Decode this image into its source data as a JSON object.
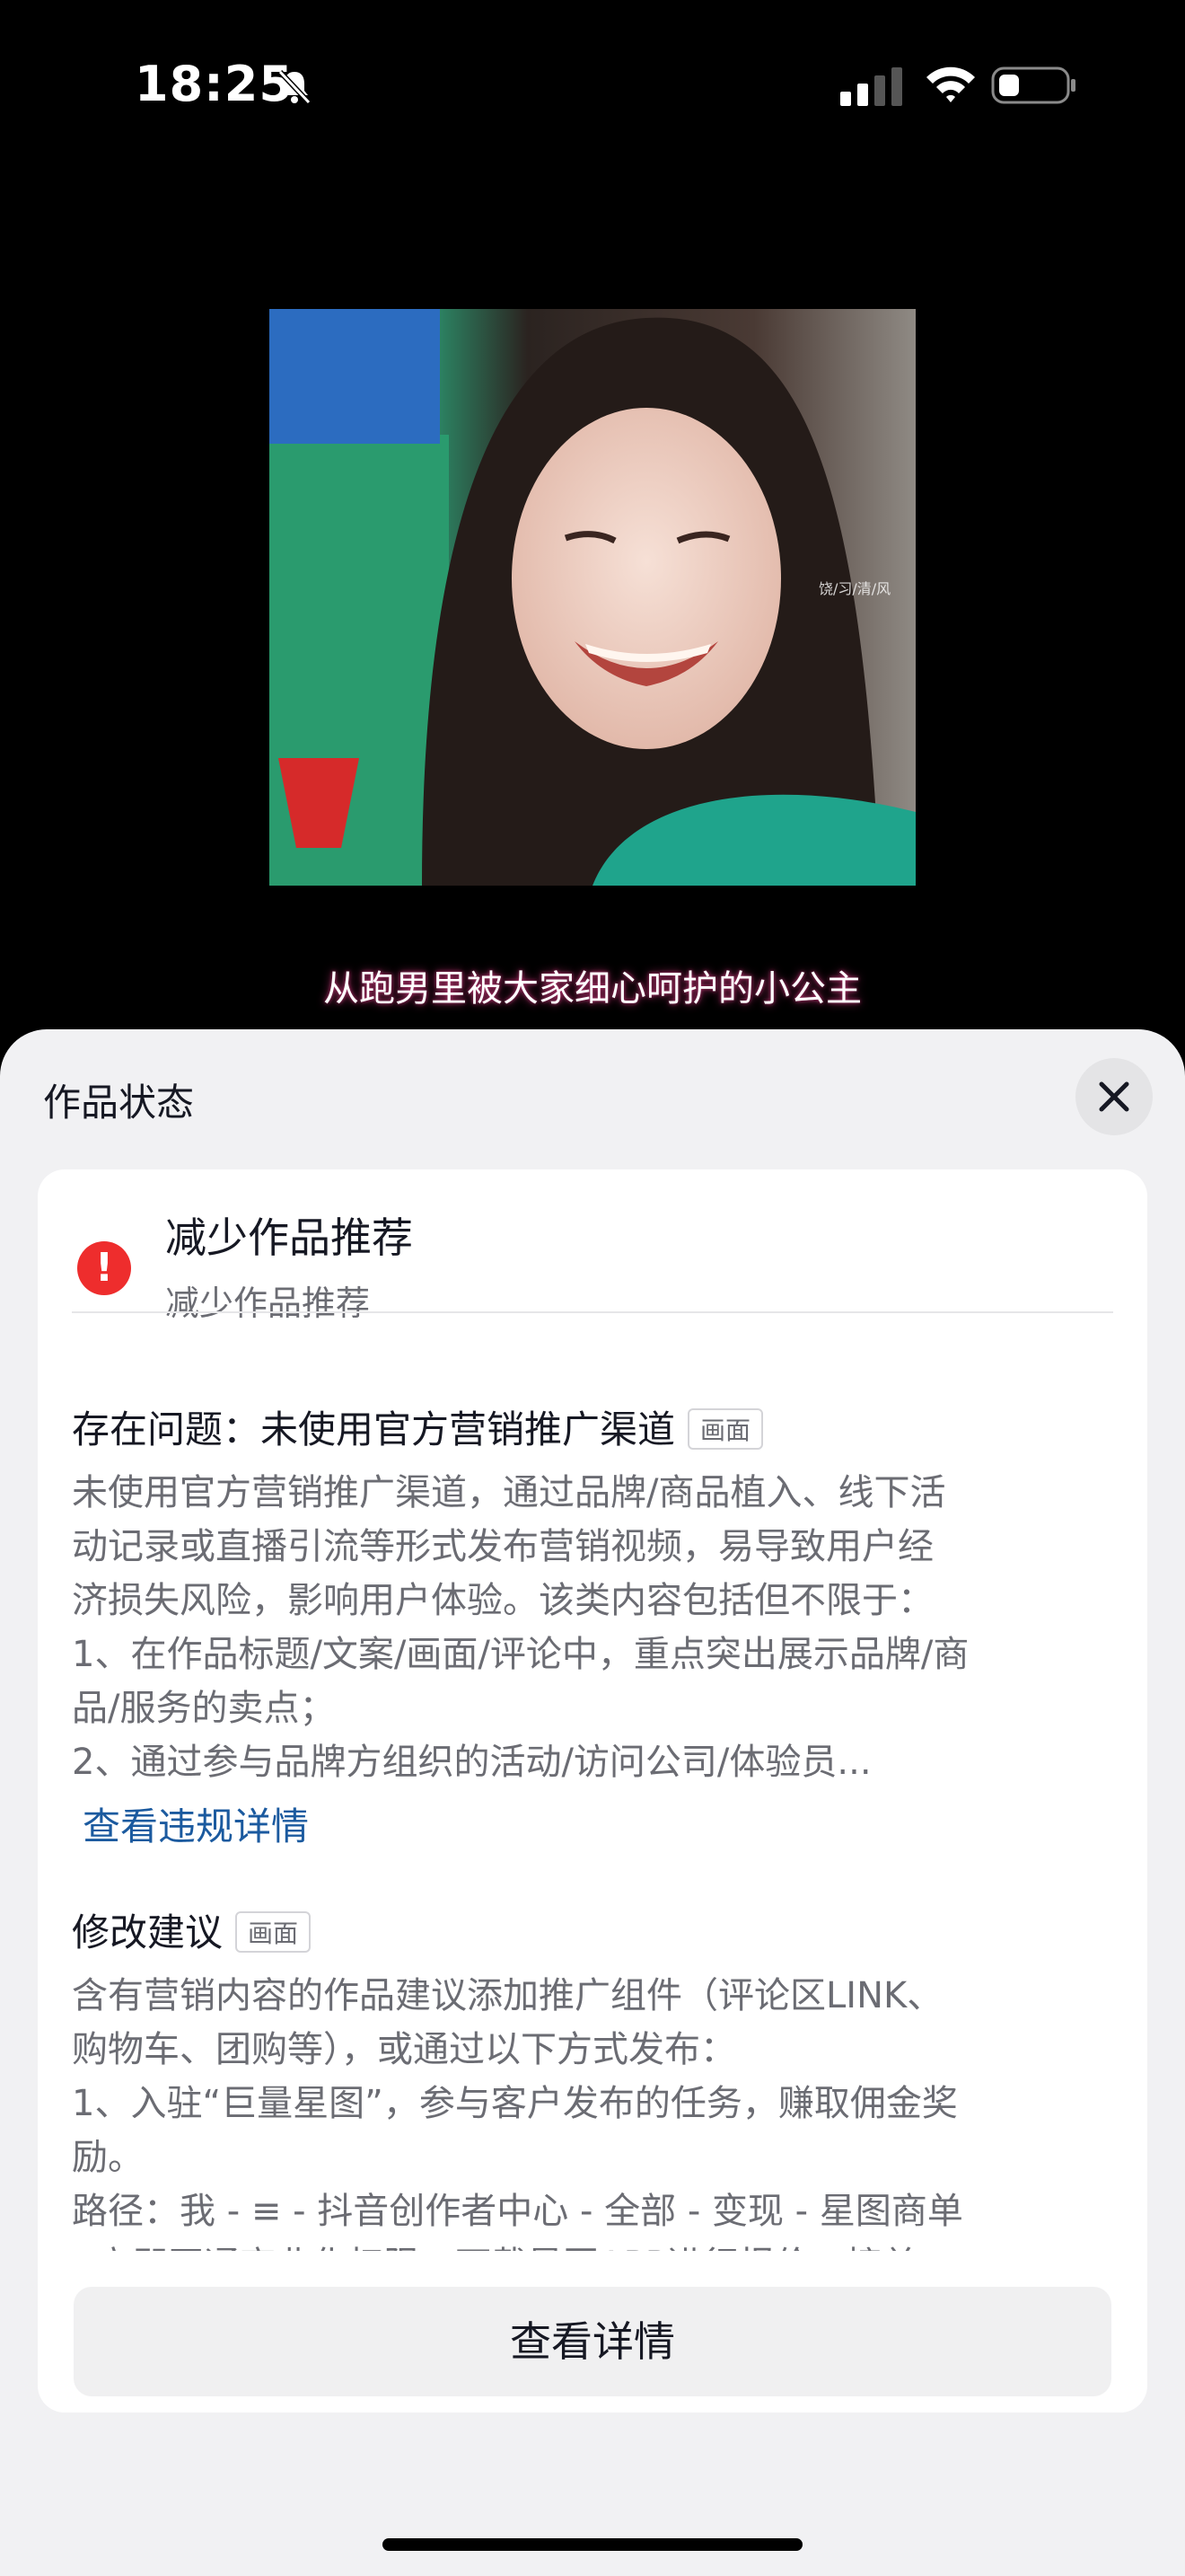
{
  "status_bar": {
    "time": "18:25",
    "icons": [
      "bell-slash-icon",
      "cellular-signal-icon",
      "wifi-icon",
      "battery-icon"
    ]
  },
  "video": {
    "subtitle": "从跑男里被大家细心呵护的小公主",
    "watermark": "饶/习/清/风"
  },
  "sheet": {
    "title": "作品状态",
    "close_icon": "close-icon",
    "status": {
      "icon": "warning-icon",
      "title": "减少作品推荐",
      "subtitle": "减少作品推荐"
    },
    "problem": {
      "heading": "存在问题：未使用官方营销推广渠道",
      "tag": "画面",
      "text": "未使用官方营销推广渠道，通过品牌/商品植入、线下活\n动记录或直播引流等形式发布营销视频，易导致用户经\n济损失风险，影响用户体验。该类内容包括但不限于：\n1、在作品标题/文案/画面/评论中，重点突出展示品牌/商\n品/服务的卖点；\n2、通过参与品牌方组织的活动/访问公司/体验员...",
      "link": "查看违规详情"
    },
    "suggestion": {
      "heading": "修改建议",
      "tag": "画面",
      "text": "含有营销内容的作品建议添加推广组件（评论区LINK、\n购物车、团购等），或通过以下方式发布：\n1、入驻“巨量星图”，参与客户发布的任务，赚取佣金奖\n励。\n路径：我 - ≡ - 抖音创作者中心 - 全部 - 变现 - 星图商单\n- 立即开通商业化权限，下载星图APP进行报价，接单"
    },
    "button": "查看详情"
  }
}
